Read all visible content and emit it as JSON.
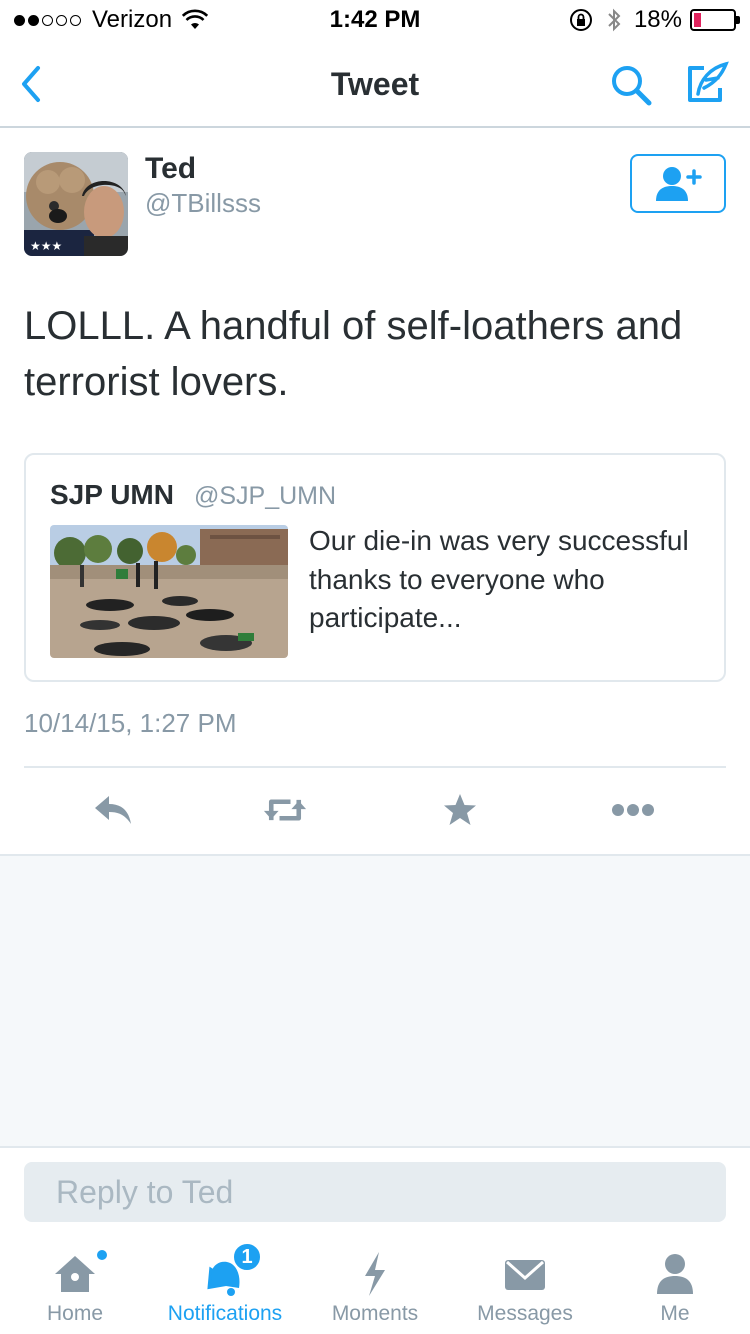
{
  "status_bar": {
    "carrier": "Verizon",
    "signal_bars_filled": 2,
    "signal_bars_total": 5,
    "time": "1:42 PM",
    "battery_percent": "18%",
    "battery_level": 0.18
  },
  "nav": {
    "title": "Tweet",
    "icons": [
      "back-chevron-icon",
      "search-icon",
      "compose-tweet-icon"
    ]
  },
  "tweet": {
    "author_name": "Ted",
    "author_handle": "@TBillsss",
    "text": "LOLLL. A handful of self-loathers and terrorist lovers.",
    "timestamp": "10/14/15, 1:27 PM",
    "follow_icon": "add-user-icon"
  },
  "quoted_tweet": {
    "author_name": "SJP UMN",
    "author_handle": "@SJP_UMN",
    "text": "Our die-in was very successful thanks to everyone who participate..."
  },
  "actions": [
    "reply-icon",
    "retweet-icon",
    "like-star-icon",
    "more-icon"
  ],
  "reply": {
    "placeholder": "Reply to Ted"
  },
  "tabs": [
    {
      "label": "Home",
      "icon": "home-icon"
    },
    {
      "label": "Notifications",
      "icon": "bell-icon",
      "badge": "1"
    },
    {
      "label": "Moments",
      "icon": "lightning-icon"
    },
    {
      "label": "Messages",
      "icon": "envelope-icon"
    },
    {
      "label": "Me",
      "icon": "person-icon"
    }
  ],
  "colors": {
    "accent": "#1da1f2",
    "icon_gray": "#8899a6",
    "text": "#292f33",
    "battery_low": "#e0245e"
  }
}
